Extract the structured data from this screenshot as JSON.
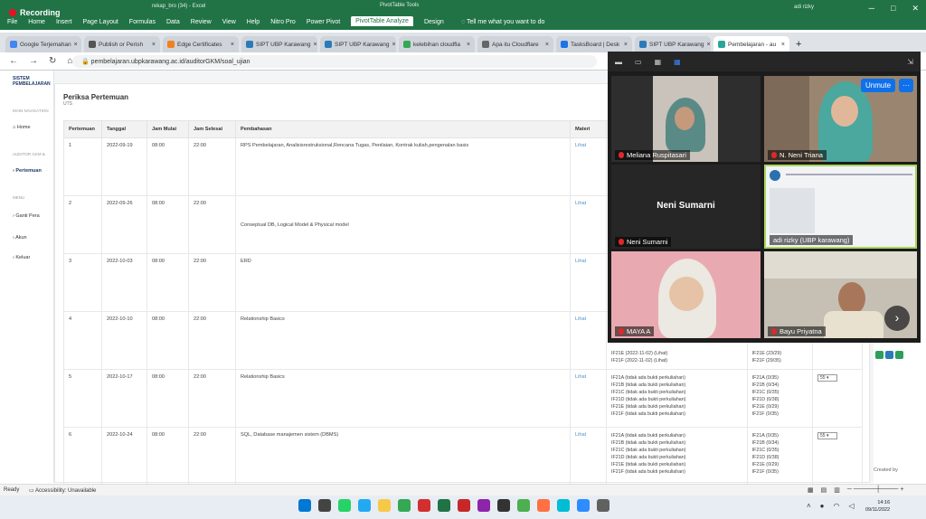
{
  "excel": {
    "recording": "Recording",
    "doc": "rekap_bro (34) - Excel",
    "tools": "PivotTable Tools",
    "user": "adi rizky",
    "ribbon": [
      "File",
      "Home",
      "Insert",
      "Page Layout",
      "Formulas",
      "Data",
      "Review",
      "View",
      "Help",
      "Nitro Pro",
      "Power Pivot",
      "PivotTable Analyze",
      "Design"
    ],
    "tellme": "Tell me what you want to do",
    "status_ready": "Ready",
    "status_access": "Accessibility: Unavailable"
  },
  "browser": {
    "tabs": [
      "Google Terjemahan",
      "Publish or Perish",
      "Edge Certificates",
      "SIPT UBP Karawang",
      "SIPT UBP Karawang",
      "kelebihan cloudfla",
      "Apa itu Cloudflare",
      "TasksBoard | Desk",
      "SIPT UBP Karawang",
      "Pembelajaran - au"
    ],
    "url": "pembelajaran.ubpkarawang.ac.id/auditorGKM/soal_ujian"
  },
  "site": {
    "logo": "SISTEM PEMBELAJARAN",
    "sec1": "MAIN NAVIGATION",
    "home": "Home",
    "sec2": "AUDITOR GKM &",
    "pertemuan": "Pertemuan",
    "sec3": "MENU",
    "ganti": "Ganti Pera",
    "akun": "Akun",
    "keluar": "Keluar",
    "created": "Created by"
  },
  "main": {
    "title": "Periksa Pertemuan",
    "subtitle": "UTS",
    "headers": [
      "Pertemuan",
      "Tanggal",
      "Jam Mulai",
      "Jam Selesai",
      "Pembahasan",
      "Materi"
    ],
    "rows": [
      {
        "no": "1",
        "date": "2022-09-19",
        "start": "08:00",
        "end": "22:00",
        "topic": "RPS Pembelajaran, Analisisrestruksional,Rencana Tugas, Penilaian, Kontrak kuliah,pengenalan basis",
        "materi": "Lihat"
      },
      {
        "no": "2",
        "date": "2022-09-26",
        "start": "08:00",
        "end": "22:00",
        "topic": "Conseptual DB, Logical Model & Physical model",
        "materi": "Lihat"
      },
      {
        "no": "3",
        "date": "2022-10-03",
        "start": "08:00",
        "end": "22:00",
        "topic": "ERD",
        "materi": "Lihat"
      },
      {
        "no": "4",
        "date": "2022-10-10",
        "start": "08:00",
        "end": "22:00",
        "topic": "Relationship Basics",
        "materi": "Lihat"
      },
      {
        "no": "5",
        "date": "2022-10-17",
        "start": "08:00",
        "end": "22:00",
        "topic": "Relationship Basics",
        "materi": "Lihat"
      },
      {
        "no": "6",
        "date": "2022-10-24",
        "start": "08:00",
        "end": "22:00",
        "topic": "SQL, Database manajemen sistem (DBMS)",
        "materi": "Lihat"
      }
    ],
    "row4_extra": [
      "IF21E (2022-11-02) (Lihat)",
      "IF21F (2022-11-02) (Lihat)"
    ],
    "row4_counts": [
      "IF21E (23/29)",
      "IF21F (29/35)"
    ],
    "row5_kelas": [
      "IF21A (tidak ada bukti perkuliahan)",
      "IF21B (tidak ada bukti perkuliahan)",
      "IF21C (tidak ada bukti perkuliahan)",
      "IF21D (tidak ada bukti perkuliahan)",
      "IF21E (tidak ada bukti perkuliahan)",
      "IF21F (tidak ada bukti perkuliahan)"
    ],
    "row5_counts": [
      "IF21A (0/35)",
      "IF21B (0/34)",
      "IF21C (0/35)",
      "IF21D (0/38)",
      "IF21E (0/29)",
      "IF21F (0/35)"
    ],
    "row6_kelas": [
      "IF21A (tidak ada bukti perkuliahan)",
      "IF21B (tidak ada bukti perkuliahan)",
      "IF21C (tidak ada bukti perkuliahan)",
      "IF21D (tidak ada bukti perkuliahan)",
      "IF21E (tidak ada bukti perkuliahan)",
      "IF21F (tidak ada bukti perkuliahan)"
    ],
    "row6_counts": [
      "IF21A (0/35)",
      "IF21B (0/34)",
      "IF21C (0/35)",
      "IF21D (0/38)",
      "IF21E (0/29)",
      "IF21F (0/35)"
    ],
    "select_value": "55"
  },
  "zoom": {
    "unmute": "Unmute",
    "more": "···",
    "participants": [
      "Meliana Ruspitasari",
      "N. Neni Triana",
      "Neni Sumarni",
      "adi rizky (UBP karawang)",
      "MAYA A",
      "Bayu Priyatna"
    ],
    "big_name": "Neni Sumarni"
  },
  "taskbar": {
    "time": "14:16",
    "date": "09/11/2022"
  }
}
